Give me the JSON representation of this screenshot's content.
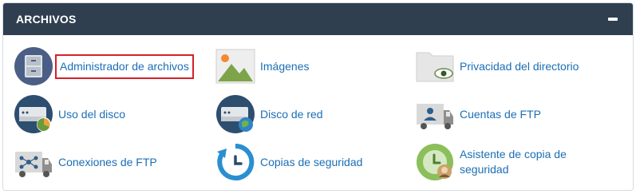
{
  "panel": {
    "title": "ARCHIVOS",
    "collapse_icon": "minus-icon"
  },
  "items": [
    {
      "label": "Administrador de archivos",
      "icon": "file-cabinet-icon"
    },
    {
      "label": "Imágenes",
      "icon": "image-icon"
    },
    {
      "label": "Privacidad del directorio",
      "icon": "folder-eye-icon"
    },
    {
      "label": "Uso del disco",
      "icon": "disk-usage-icon"
    },
    {
      "label": "Disco de red",
      "icon": "network-disk-icon"
    },
    {
      "label": "Cuentas de FTP",
      "icon": "ftp-accounts-icon"
    },
    {
      "label": "Conexiones de FTP",
      "icon": "ftp-connections-icon"
    },
    {
      "label": "Copias de seguridad",
      "icon": "backup-icon"
    },
    {
      "label": "Asistente de copia de seguridad",
      "icon": "backup-wizard-icon"
    }
  ],
  "colors": {
    "header_bg": "#2f3f50",
    "link": "#1b6eb5",
    "highlight_border": "#d52128"
  }
}
